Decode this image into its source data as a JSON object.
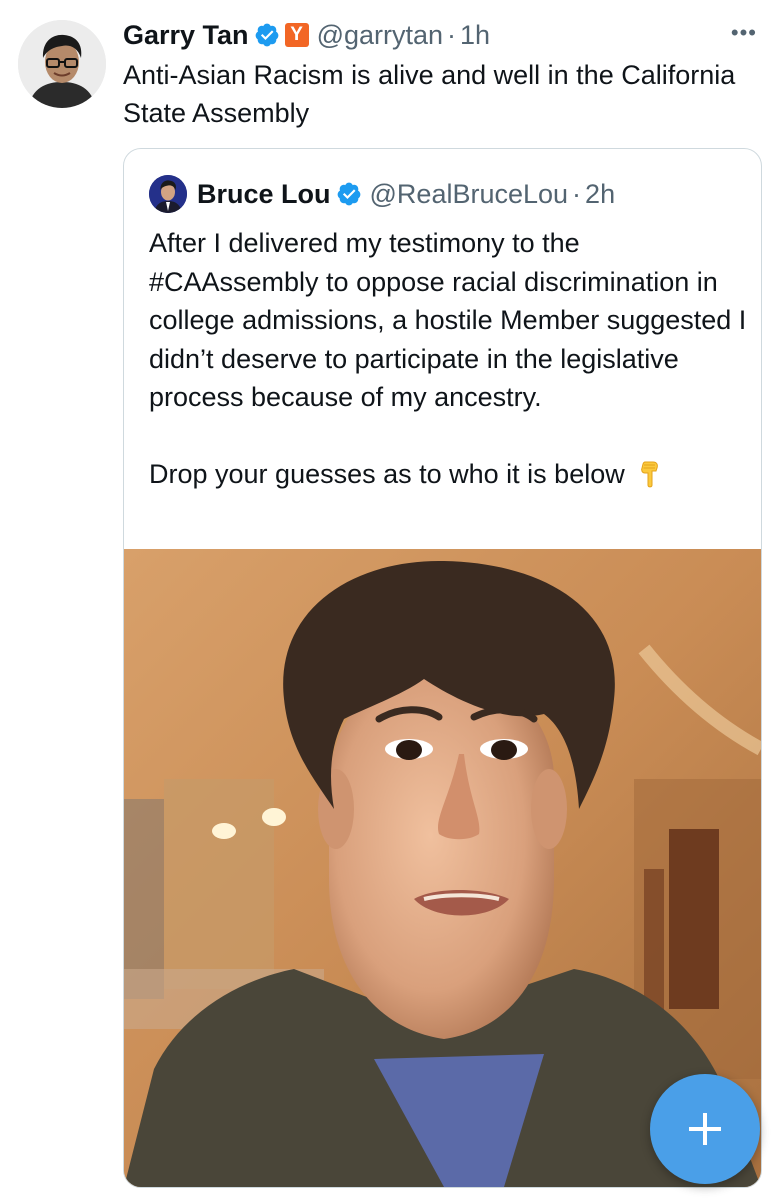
{
  "tweet": {
    "author": {
      "display_name": "Garry Tan",
      "handle": "@garrytan",
      "verified": true,
      "affiliate_badge": "Y",
      "affiliate_color": "#f26625"
    },
    "dot": "·",
    "time": "1h",
    "more_icon": "more-horizontal-icon",
    "text": "Anti-Asian Racism is alive and well in the California State Assembly"
  },
  "quoted_tweet": {
    "author": {
      "display_name": "Bruce Lou",
      "handle": "@RealBruceLou",
      "verified": true
    },
    "dot": "·",
    "time": "2h",
    "text": "After I delivered my testimony to the #CAAssembly to oppose racial discrimination in college admissions, a hostile Member suggested I didn’t deserve to participate in the legislative process because of my ancestry.\n\nDrop your guesses as to who it is below",
    "emoji": "backhand-index-pointing-down-icon",
    "media": "video-thumbnail"
  },
  "compose_button": {
    "icon": "plus-icon",
    "color": "#4a9fe8"
  },
  "colors": {
    "text": "#0f1419",
    "secondary": "#536471",
    "border": "#cfd9de",
    "verified": "#1d9bf0"
  }
}
